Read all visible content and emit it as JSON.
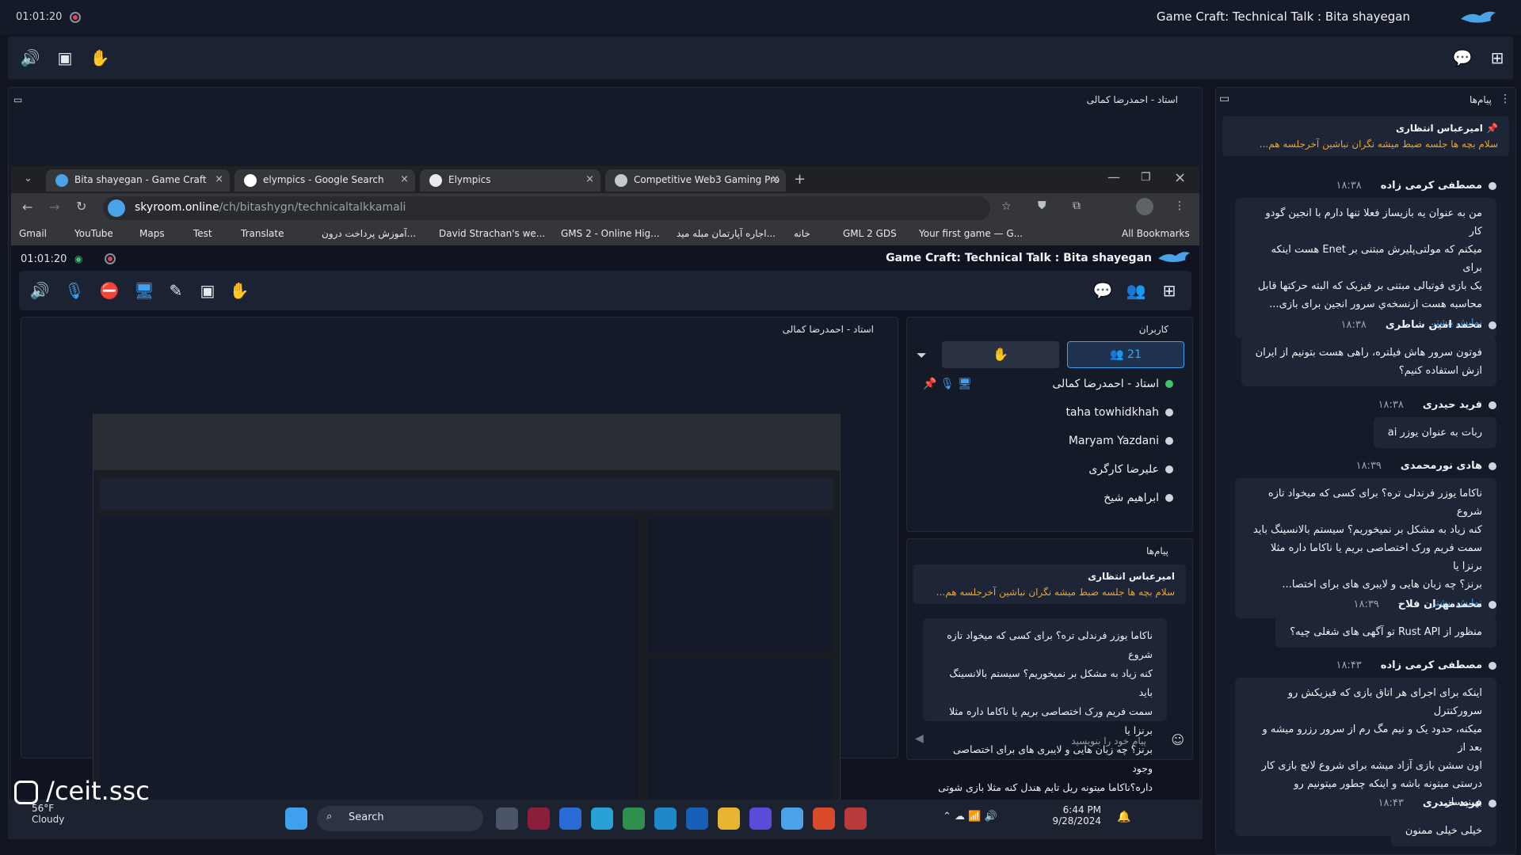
{
  "top_bar": {
    "timer": "01:01:20",
    "title": "Game Craft: Technical Talk : Bita shayegan"
  },
  "share_panel": {
    "title": "استاد - احمدرضا کمالی"
  },
  "browser": {
    "tabs": [
      {
        "label": "Bita shayegan - Game Craft"
      },
      {
        "label": "elympics - Google Search"
      },
      {
        "label": "Elympics"
      },
      {
        "label": "Competitive Web3 Gaming Pro"
      }
    ],
    "url_host": "skyroom.online",
    "url_path": "/ch/bitashygn/technicaltalkkamali",
    "bookmarks": [
      "Gmail",
      "YouTube",
      "Maps",
      "Test",
      "Translate",
      "آموزش پرداخت درون...",
      "David Strachan's we...",
      "GMS 2 - Online Hig...",
      "اجاره آپارتمان مبله مید...",
      "خانه",
      "GML 2 GDS",
      "Your first game — G...",
      "All Bookmarks"
    ]
  },
  "inner": {
    "timer": "01:01:20",
    "title": "Game Craft: Technical Talk : Bita shayegan",
    "share_title": "استاد - احمدرضا کمالی",
    "users_title": "کاربران",
    "user_count": "21",
    "users": [
      "استاد - احمدرضا کمالی",
      "taha towhidkhah",
      "Maryam Yazdani",
      "علیرضا کارگری",
      "ابراهیم شیخ"
    ],
    "messages_title": "پیام‌ها",
    "pinned_name": "امیرعباس انتظاری",
    "pinned_text": "سلام بچه ها جلسه ضبط میشه نگران نباشین آخرجلسه هم...",
    "message_lines": [
      "ناکاما یوزر فرندلی تره؟ برای کسی که میخواد تازه شروع",
      "کنه زیاد به مشکل بر نمیخوریم؟ سیستم بالانسینگ باید",
      "سمت فریم ورک اختصاصی بریم یا ناکاما داره مثلا برنزا یا",
      "برنز؟ چه زبان هایی و لایبری های برای اختصاصی وجود",
      "داره؟ناکاما میتونه ریل تایم هندل کنه مثلا بازی شوتی"
    ],
    "input_placeholder": "پیام خود را بنویسید"
  },
  "taskbar": {
    "weather_temp": "56°F",
    "weather_desc": "Cloudy",
    "search": "Search",
    "time": "6:44 PM",
    "date": "9/28/2024"
  },
  "watermark": "/ceit.ssc",
  "chat": {
    "title": "پیام‌ها",
    "pinned_name": "امیرعباس انتظاری",
    "pinned_text": "سلام بچه ها جلسه ضبط میشه نگران نباشین آخرجلسه هم...",
    "more_label": "نمایش بیشتر",
    "messages": [
      {
        "name": "مصطفی کرمی زاده",
        "time": "۱۸:۳۸",
        "lines": [
          "من به عنوان یه بازیساز فعلا تنها دارم با انجین گودو کار",
          "میکنم که مولتی‌پلیرش مبتنی بر Enet هست اینکه برای",
          "یک بازی فوتبالی مبتنی بر فیزیک که البته حرکتها قابل",
          "محاسبه هست ازنسخه‌ي سرور انجین برای بازی..."
        ],
        "more": true
      },
      {
        "name": "محمد امین شاطری",
        "time": "۱۸:۳۸",
        "lines": [
          "فوتون سرور هاش فیلتره، راهی هست بتونیم از ایران",
          "ازش استفاده کنیم؟"
        ],
        "more": false
      },
      {
        "name": "فرید حیدری",
        "time": "۱۸:۳۸",
        "lines": [
          "ربات به عنوان یوزر ai"
        ],
        "more": false
      },
      {
        "name": "هادی نورمحمدی",
        "time": "۱۸:۳۹",
        "lines": [
          "ناکاما یوزر فرندلی تره؟ برای کسی که میخواد تازه شروع",
          "کنه زیاد به مشکل بر نمیخوریم؟ سیستم بالانسینگ باید",
          "سمت فریم ورک اختصاصی بریم یا ناکاما داره مثلا برنزا یا",
          "برنز؟ چه زبان هایی و لایبری های برای اختصا..."
        ],
        "more": true
      },
      {
        "name": "محمدمهران فلاح",
        "time": "۱۸:۳۹",
        "lines": [
          "منظور از Rust API تو آگهی های شغلی چیه؟"
        ],
        "more": false
      },
      {
        "name": "مصطفی کرمی زاده",
        "time": "۱۸:۴۳",
        "lines": [
          "اینکه برای اجرای هر اتاق بازی که فیزیکش رو سرورکنترل",
          "میکنه، حدود یک و نیم مگ رم از سرور رزرو میشه و بعد از",
          "اون سشن بازی آزاد میشه برای شروع لانچ بازی کار",
          "درستی میتونه باشه و اینکه چطور میتونیم رو بهینه‌ساز..."
        ],
        "more": true
      },
      {
        "name": "فرید حیدری",
        "time": "۱۸:۴۳",
        "lines": [
          "خیلی خیلی ممنون"
        ],
        "more": false
      }
    ]
  }
}
